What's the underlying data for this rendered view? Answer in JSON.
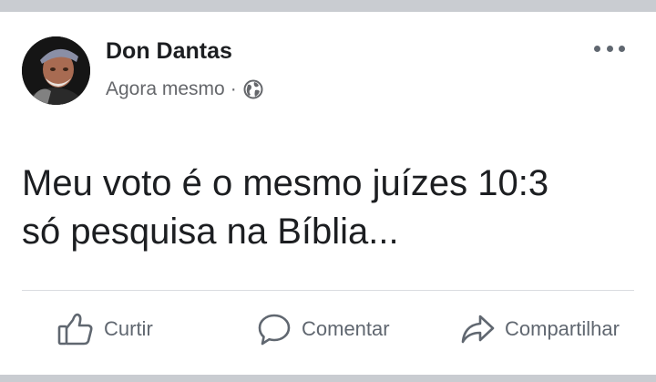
{
  "post": {
    "author": "Don Dantas",
    "timestamp": "Agora mesmo",
    "separator": "·",
    "privacy_icon": "globe-icon",
    "text_line1": "Meu voto é o mesmo juízes 10:3",
    "text_line2": "só pesquisa na Bíblia..."
  },
  "actions": {
    "like_label": "Curtir",
    "comment_label": "Comentar",
    "share_label": "Compartilhar"
  },
  "colors": {
    "author": "#1c1e21",
    "secondary": "#65676b",
    "icon": "#606770",
    "background": "#c9ccd1",
    "card": "#ffffff"
  }
}
